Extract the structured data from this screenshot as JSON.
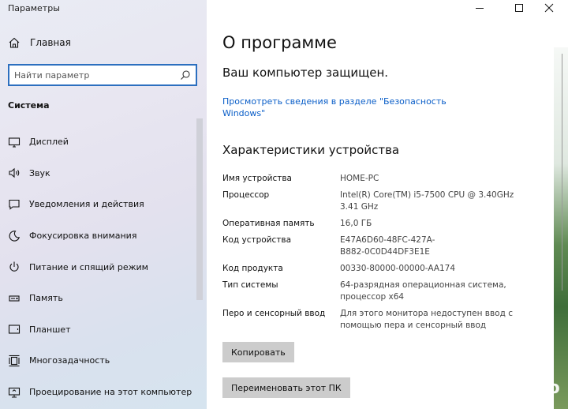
{
  "window": {
    "title": "Параметры"
  },
  "sidebar": {
    "home_label": "Главная",
    "search_placeholder": "Найти параметр",
    "section_title": "Система",
    "items": [
      {
        "label": "Дисплей",
        "icon": "display-icon"
      },
      {
        "label": "Звук",
        "icon": "sound-icon"
      },
      {
        "label": "Уведомления и действия",
        "icon": "notifications-icon"
      },
      {
        "label": "Фокусировка внимания",
        "icon": "focus-assist-icon"
      },
      {
        "label": "Питание и спящий режим",
        "icon": "power-icon"
      },
      {
        "label": "Память",
        "icon": "storage-icon"
      },
      {
        "label": "Планшет",
        "icon": "tablet-icon"
      },
      {
        "label": "Многозадачность",
        "icon": "multitasking-icon"
      },
      {
        "label": "Проецирование на этот компьютер",
        "icon": "projecting-icon"
      }
    ]
  },
  "main": {
    "page_title": "О программе",
    "protection_status": "Ваш компьютер защищен.",
    "security_link": "Просмотреть сведения в разделе \"Безопасность Windows\"",
    "specs_title": "Характеристики устройства",
    "specs": [
      {
        "label": "Имя устройства",
        "value": "HOME-PC"
      },
      {
        "label": "Процессор",
        "value": "Intel(R) Core(TM) i5-7500 CPU @ 3.40GHz 3.41 GHz"
      },
      {
        "label": "Оперативная память",
        "value": "16,0 ГБ"
      },
      {
        "label": "Код устройства",
        "value": "E47A6D60-48FC-427A-B882-0C0D44DF3E1E"
      },
      {
        "label": "Код продукта",
        "value": "00330-80000-00000-AA174"
      },
      {
        "label": "Тип системы",
        "value": "64-разрядная операционная система, процессор x64"
      },
      {
        "label": "Перо и сенсорный ввод",
        "value": "Для этого монитора недоступен ввод с помощью пера и сенсорный ввод"
      }
    ],
    "copy_button": "Копировать",
    "rename_button": "Переименовать этот ПК"
  },
  "watermark": "Avito",
  "colors": {
    "accent": "#2c6fbf",
    "link": "#0a5ec8",
    "button": "#cccccc"
  }
}
